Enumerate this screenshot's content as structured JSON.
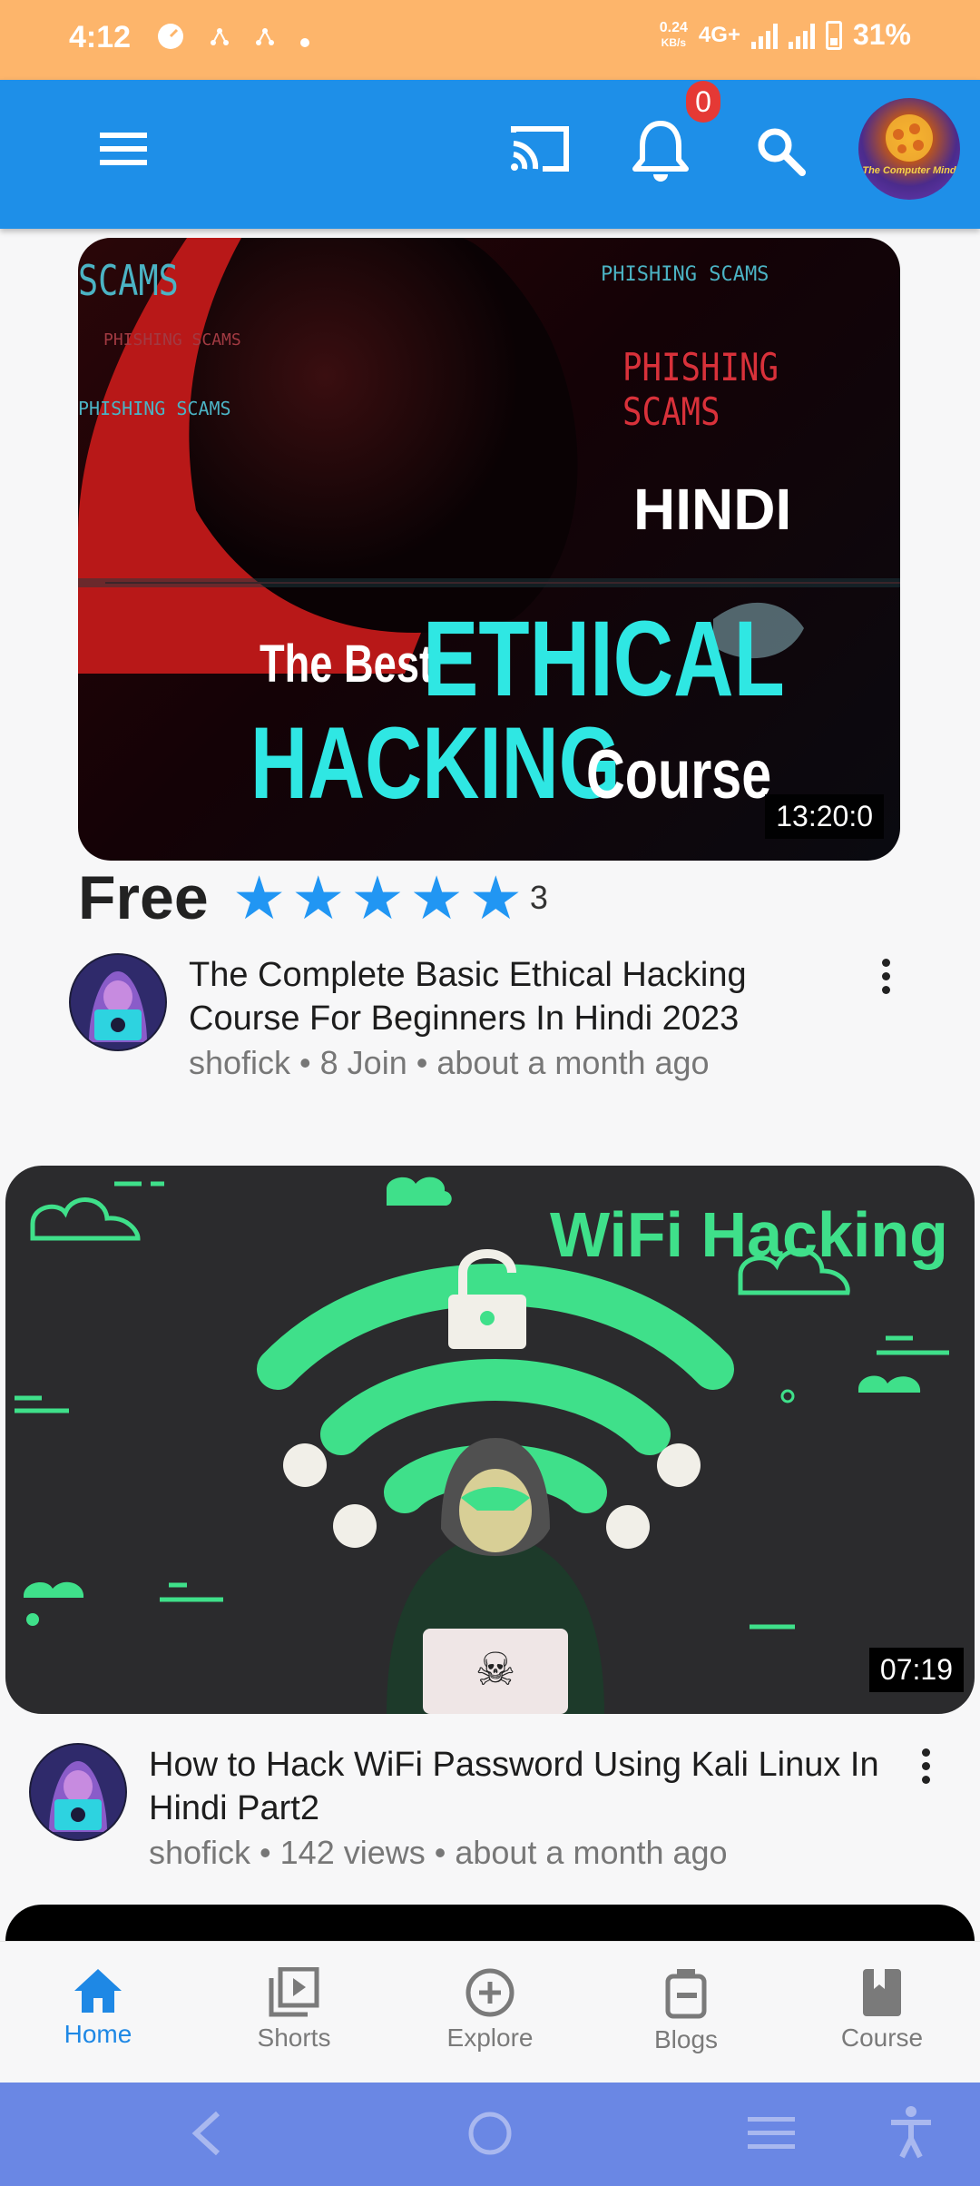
{
  "status_bar": {
    "time": "4:12",
    "network_speed_value": "0.24",
    "network_speed_unit": "KB/s",
    "network_type": "4G+",
    "battery": "31%"
  },
  "app_bar": {
    "notification_count": "0",
    "logo_text": "The Computer Mind"
  },
  "videos": [
    {
      "thumbnail_text": {
        "line_a": "HINDI",
        "line_b": "The Best",
        "line_c": "ETHICAL",
        "line_d": "HACKING",
        "line_e": "Course",
        "overlay_1": "SCAMS",
        "overlay_2": "PHISHING SCAMS",
        "overlay_3": "PHISHING SCAMS",
        "overlay_4": "PHISHING SCAMS",
        "overlay_5": "PHISHING SCAMS"
      },
      "duration": "13:20:0",
      "price": "Free",
      "rating_stars": 5,
      "rating_count": "3",
      "title": "The Complete Basic Ethical Hacking Course For Beginners In Hindi 2023",
      "meta": "shofick • 8 Join • about a month ago"
    },
    {
      "thumbnail_text": {
        "line_a": "WiFi Hacking"
      },
      "duration": "07:19",
      "title": "How to Hack WiFi Password Using Kali Linux In Hindi Part2",
      "meta": "shofick • 142 views • about a month ago"
    }
  ],
  "bottom_nav": [
    {
      "label": "Home",
      "icon": "home-icon",
      "active": true
    },
    {
      "label": "Shorts",
      "icon": "video-library-icon",
      "active": false
    },
    {
      "label": "Explore",
      "icon": "add-circle-icon",
      "active": false
    },
    {
      "label": "Blogs",
      "icon": "blog-icon",
      "active": false
    },
    {
      "label": "Course",
      "icon": "book-icon",
      "active": false
    }
  ],
  "colors": {
    "status_bar": "#fdb56b",
    "app_bar": "#1e8fe8",
    "accent": "#1e88e5",
    "star": "#2196f3",
    "badge": "#e53935",
    "system_nav": "#6a87e4",
    "wifi_green": "#3fe08a"
  }
}
